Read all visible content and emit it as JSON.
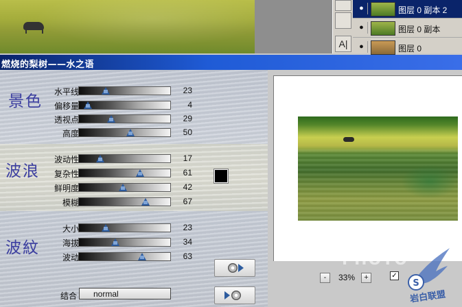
{
  "layers": {
    "items": [
      {
        "name": "图层 0 副本 2",
        "selected": true
      },
      {
        "name": "图层 0 副本",
        "selected": false
      },
      {
        "name": "图层 0",
        "selected": false
      }
    ]
  },
  "tools": {
    "type_tool": "A|"
  },
  "dialog": {
    "title": "燃烧的梨树——水之语",
    "sections": {
      "scenery": {
        "title": "景色",
        "sliders": [
          {
            "label": "水平线",
            "value": "23",
            "fraction": 0.23
          },
          {
            "label": "偏移量",
            "value": "4",
            "fraction": 0.04
          },
          {
            "label": "透视点",
            "value": "29",
            "fraction": 0.29
          },
          {
            "label": "高度",
            "value": "50",
            "fraction": 0.5
          }
        ]
      },
      "waves": {
        "title": "波浪",
        "sliders": [
          {
            "label": "波动性",
            "value": "17",
            "fraction": 0.17
          },
          {
            "label": "复杂性",
            "value": "61",
            "fraction": 0.61
          },
          {
            "label": "鲜明度",
            "value": "42",
            "fraction": 0.42
          },
          {
            "label": "模糊",
            "value": "67",
            "fraction": 0.67
          }
        ],
        "color": "#000000"
      },
      "ripples": {
        "title": "波紋",
        "sliders": [
          {
            "label": "大小",
            "value": "23",
            "fraction": 0.23
          },
          {
            "label": "海拔",
            "value": "34",
            "fraction": 0.34
          },
          {
            "label": "波动",
            "value": "63",
            "fraction": 0.63
          }
        ]
      }
    },
    "combine": {
      "label": "结合",
      "value": "normal"
    },
    "preview": {
      "zoom_minus": "-",
      "zoom_value": "33%",
      "zoom_plus": "+",
      "check_mark": "✓"
    }
  },
  "watermark": {
    "text": "PHOTO",
    "logo_text": "岩白联盟"
  },
  "colors": {
    "title_bar": "#0a246a",
    "section_title": "#3b3ea0",
    "knob": "#2c5b9e",
    "layer_selected": "#0a246a"
  }
}
